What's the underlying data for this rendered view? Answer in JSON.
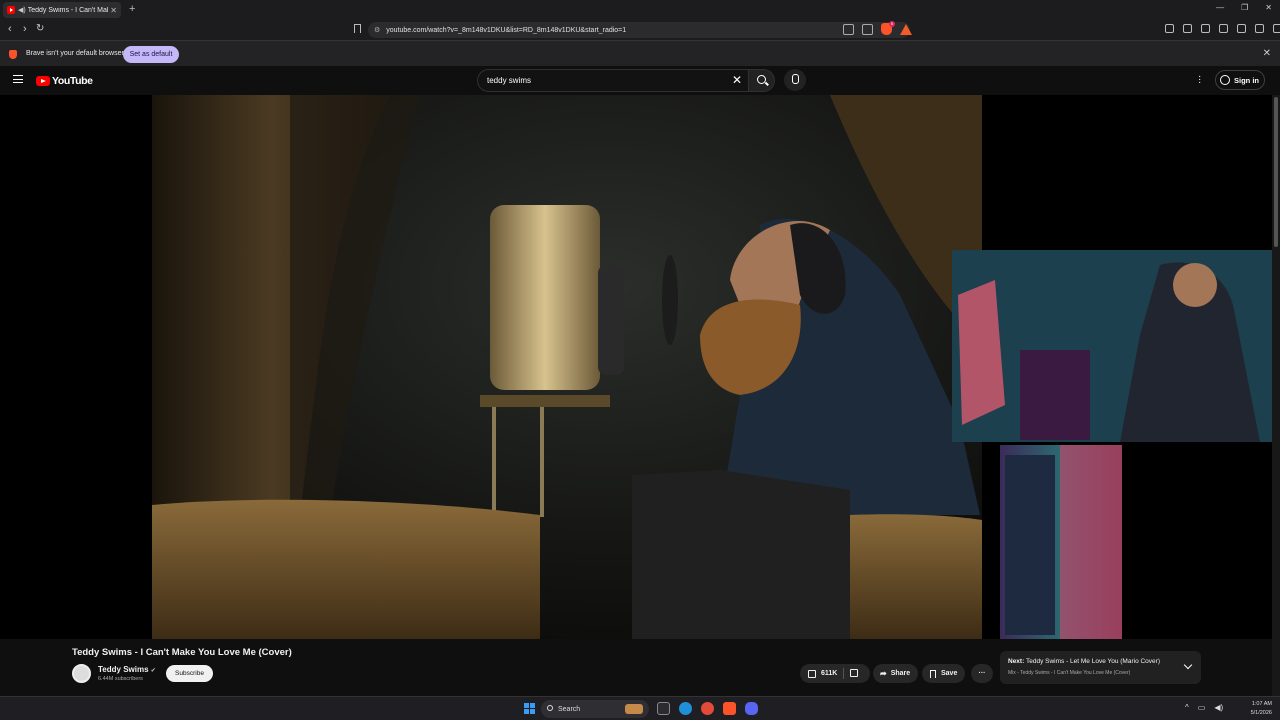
{
  "browser": {
    "tab_title": "Teddy Swims - I Can't Make Y",
    "url": "youtube.com/watch?v=_8m148v1DKU&list=RD_8m148v1DKU&start_radio=1",
    "shield_badge": "6",
    "infobar_text": "Brave isn't your default browser",
    "set_default_label": "Set as default"
  },
  "youtube": {
    "logo_text": "YouTube",
    "search_value": "teddy swims",
    "sign_in_label": "Sign in"
  },
  "video": {
    "title": "Teddy Swims - I Can't Make You Love Me (Cover)",
    "channel_name": "Teddy Swims",
    "subscribers": "6.44M subscribers",
    "subscribe_label": "Subscribe",
    "likes": "611K",
    "share_label": "Share",
    "save_label": "Save",
    "next_prefix": "Next:",
    "next_title": "Teddy Swims - Let Me Love You (Mario Cover)",
    "next_mix": "Mix - Teddy Swims - I Can't Make You Love Me (Cover)"
  },
  "taskbar": {
    "search_label": "Search",
    "time": "1:07 AM",
    "date": "5/1/2026"
  },
  "colors": {
    "yt_red": "#ff0000",
    "brave_orange": "#fb542b",
    "set_default_bg": "#c5b8f8"
  }
}
